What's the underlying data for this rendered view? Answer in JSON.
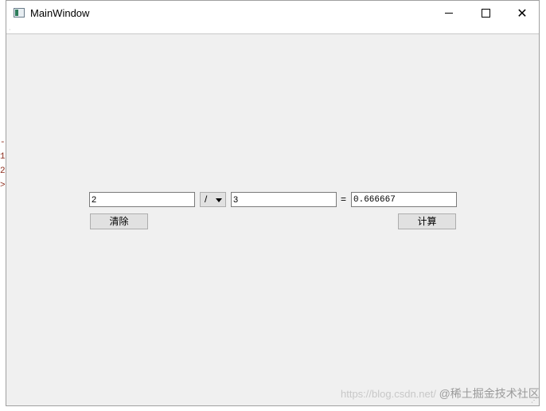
{
  "window": {
    "title": "MainWindow",
    "minimize_icon": "minimize-icon",
    "maximize_icon": "maximize-icon",
    "close_glyph": "✕"
  },
  "background_fragments": [
    "-",
    "1",
    "2",
    ">"
  ],
  "calculator": {
    "operand1": "2",
    "operator": "/",
    "operand2": "3",
    "equals": "=",
    "result": "0.666667",
    "clear_label": "清除",
    "compute_label": "计算"
  },
  "watermark": {
    "url": "https://blog.csdn.net/",
    "brand": "@稀土掘金技术社区"
  },
  "colors": {
    "window_bg": "#f0f0f0",
    "button_bg": "#e1e1e1",
    "field_border": "#7a7a7a"
  }
}
